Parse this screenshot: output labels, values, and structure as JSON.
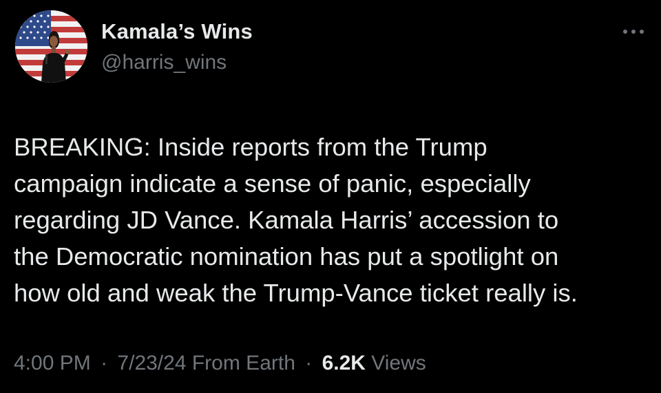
{
  "author": {
    "display_name": "Kamala’s Wins",
    "handle": "@harris_wins",
    "avatar_icon": "profile-photo-flag-background"
  },
  "tweet": {
    "text": "BREAKING: Inside reports from the Trump\ncampaign indicate a sense of panic, especially\nregarding JD Vance. Kamala Harris’ accession to\nthe Democratic nomination has put a spotlight on\nhow old and weak the Trump-Vance ticket really is."
  },
  "meta": {
    "time": "4:00 PM",
    "separator": "·",
    "date": "7/23/24",
    "source": "From Earth",
    "views_count": "6.2K",
    "views_label": "Views"
  },
  "icons": {
    "more": "more-horizontal-icon"
  },
  "colors": {
    "background": "#000000",
    "primary_text": "#e7e9ea",
    "secondary_text": "#71767b"
  }
}
